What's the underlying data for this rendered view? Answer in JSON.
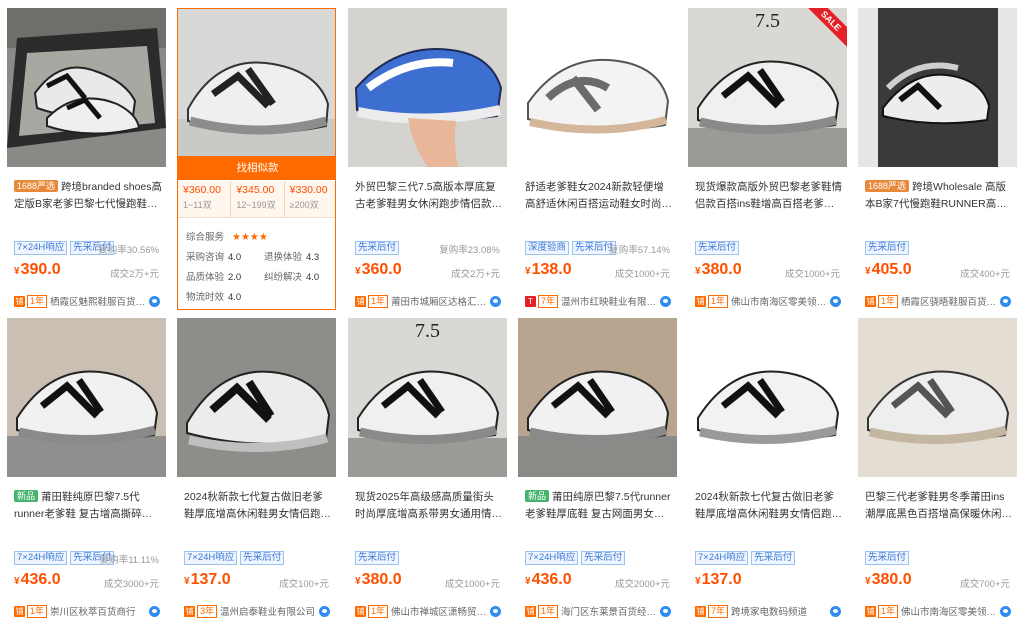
{
  "hover_card": {
    "find_label": "找相似款",
    "tiers": [
      {
        "price": "¥360.00",
        "qty": "1~11双"
      },
      {
        "price": "¥345.00",
        "qty": "12~199双"
      },
      {
        "price": "¥330.00",
        "qty": "≥200双"
      }
    ],
    "service_label": "综合服务",
    "service_stars": "★★★★",
    "metrics": [
      {
        "label": "采购咨询",
        "value": "4.0"
      },
      {
        "label": "退换体验",
        "value": "4.3"
      },
      {
        "label": "品质体验",
        "value": "2.0"
      },
      {
        "label": "纠纷解决",
        "value": "4.0"
      },
      {
        "label": "物流时效",
        "value": "4.0"
      }
    ]
  },
  "products": [
    {
      "badge": "1688严选",
      "title": "跨境branded shoes高定版B家老爹巴黎七代慢跑鞋RUNNER外贸",
      "tags": [
        "7×24H响应",
        "先采后付"
      ],
      "repurchase": "复购率30.56%",
      "price": "390.0",
      "deals": "成交2万+元",
      "years": "1年",
      "shop": "栖霞区魅熙鞋服百货商行"
    },
    {
      "badge": "",
      "title": "外贸巴黎三代7.5高版本厚底复古老爹鞋男女休闲跑步情侣款运动鞋",
      "tags": [
        "先采后付"
      ],
      "repurchase": "复购率23.08%",
      "price": "360.0",
      "deals": "成交2万+元",
      "years": "1年",
      "shop": "莆田市城厢区达格汇鞋厂"
    },
    {
      "badge": "",
      "title": "舒适老爹鞋女2024新款轻便增高舒适休闲百搭运动鞋女时尚网红潮款",
      "tags": [
        "深度验商",
        "先采后付"
      ],
      "repurchase": "复购率57.14%",
      "price": "138.0",
      "deals": "成交1000+元",
      "years": "7年",
      "shop": "温州市红映鞋业有限公司"
    },
    {
      "badge": "",
      "title": "现货爆款高版外贸巴黎老爹鞋情侣款百搭ins鞋增高百搭老爹运动鞋",
      "tags": [
        "先采后付"
      ],
      "repurchase": "",
      "price": "380.0",
      "deals": "成交1000+元",
      "years": "1年",
      "shop": "佛山市南海区零美领衔…",
      "overlay": "7.5",
      "sale": "SALE"
    },
    {
      "badge": "1688严选",
      "title": "跨境Wholesale 高版本B家7代慢跑鞋RUNNER高定版老爹7.0外",
      "tags": [
        "先采后付"
      ],
      "repurchase": "",
      "price": "405.0",
      "deals": "成交400+元",
      "years": "1年",
      "shop": "栖霞区骁晤鞋服百货商行"
    },
    {
      "badge": "新品",
      "title": "莆田鞋纯原巴黎7.5代runner老爹鞋 复古增高撕碎感透气男女运动鞋",
      "tags": [
        "7×24H响应",
        "先采后付"
      ],
      "repurchase": "复购率11.11%",
      "price": "436.0",
      "deals": "成交3000+元",
      "years": "1年",
      "shop": "崇川区秋萃百货商行"
    },
    {
      "badge": "",
      "title": "2024秋新款七代复古做旧老爹鞋厚底增高休闲鞋男女情侣跑步运动鞋",
      "tags": [
        "7×24H响应",
        "先采后付"
      ],
      "repurchase": "",
      "price": "137.0",
      "deals": "成交100+元",
      "years": "3年",
      "shop": "温州启泰鞋业有限公司"
    },
    {
      "badge": "",
      "title": "现货2025年高级感高质量街头时尚厚底增高系带男女通用情侣鞋运动",
      "tags": [
        "先采后付"
      ],
      "repurchase": "",
      "price": "380.0",
      "deals": "成交1000+元",
      "years": "1年",
      "shop": "佛山市禅城区潇畅贸易…",
      "overlay": "7.5"
    },
    {
      "badge": "新品",
      "title": "莆田纯原巴黎7.5代runner老爹鞋厚底鞋 复古网面男女增高运动鞋",
      "tags": [
        "7×24H响应",
        "先采后付"
      ],
      "repurchase": "",
      "price": "436.0",
      "deals": "成交2000+元",
      "years": "1年",
      "shop": "海门区东莱景百货经营部"
    },
    {
      "badge": "",
      "title": "2024秋新款七代复古做旧老爹鞋厚底增高休闲鞋男女情侣跑步运动鞋",
      "tags": [
        "7×24H响应",
        "先采后付"
      ],
      "repurchase": "",
      "price": "137.0",
      "deals": "",
      "years": "7年",
      "shop": "跨境家电数码频道"
    },
    {
      "badge": "",
      "title": "巴黎三代老爹鞋男冬季莆田ins潮厚底黑色百搭增高保暖休闲男女鞋",
      "tags": [
        "先采后付"
      ],
      "repurchase": "",
      "price": "380.0",
      "deals": "成交700+元",
      "years": "1年",
      "shop": "佛山市南海区零美领衔…"
    }
  ],
  "colors": {
    "accent": "#ff6a00",
    "price": "#ff5000",
    "tag_blue": "#3b78d8"
  }
}
